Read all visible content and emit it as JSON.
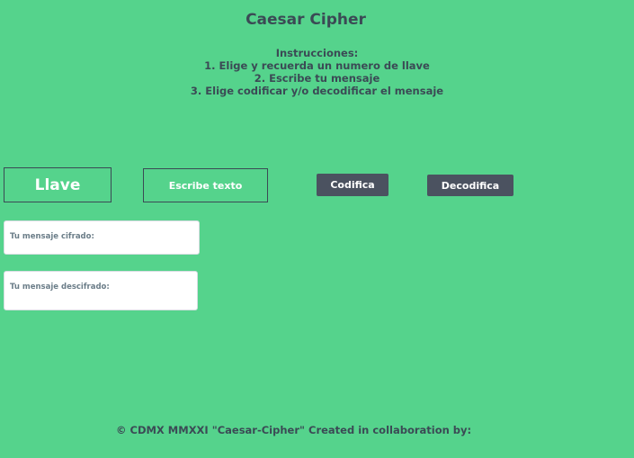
{
  "header": {
    "title": "Caesar Cipher"
  },
  "instructions": {
    "heading": "Instrucciones:",
    "steps": [
      "1. Elige y recuerda un numero de llave",
      "2. Escribe tu mensaje",
      "3. Elige codificar y/o decodificar el mensaje"
    ]
  },
  "controls": {
    "key_placeholder": "Llave",
    "text_placeholder": "Escribe texto",
    "encode_label": "Codifica",
    "decode_label": "Decodifica"
  },
  "outputs": {
    "cipher_label": "Tu mensaje cifrado:",
    "decipher_label": "Tu mensaje descifrado:"
  },
  "footer": {
    "text": "© CDMX MMXXI \"Caesar-Cipher\" Created in collaboration by:"
  },
  "colors": {
    "background": "#55d38c",
    "text": "#3b4a55",
    "button": "#4b5260"
  }
}
